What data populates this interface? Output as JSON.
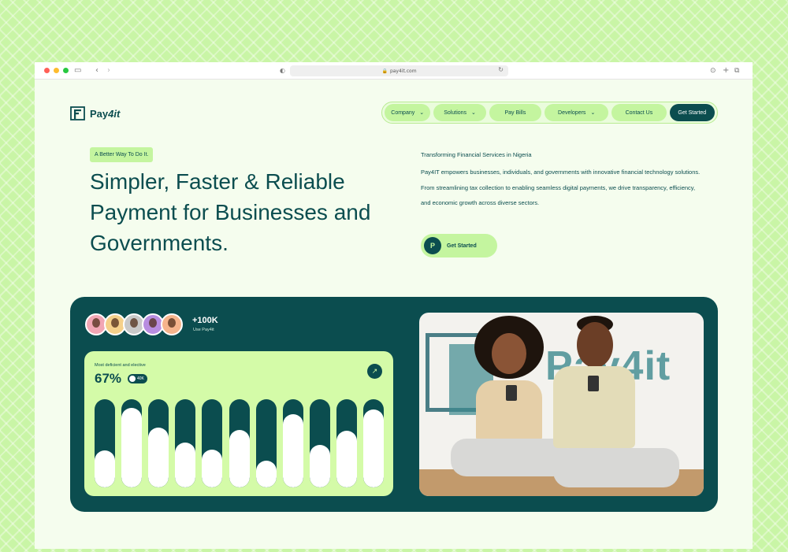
{
  "browser": {
    "url": "pay4it.com",
    "traffic_lights": [
      "#ff5f57",
      "#febc2e",
      "#28c840"
    ]
  },
  "brand": {
    "logo_mark": "P",
    "name_bold": "Pay",
    "name_italic": "4it",
    "primary": "#0b4d4f",
    "accent": "#c4f59f"
  },
  "nav": {
    "items": [
      {
        "label": "Company",
        "dropdown": true
      },
      {
        "label": "Solutions",
        "dropdown": true
      },
      {
        "label": "Pay Bills",
        "dropdown": false
      },
      {
        "label": "Developers",
        "dropdown": true
      },
      {
        "label": "Contact Us",
        "dropdown": false
      }
    ],
    "cta": "Get Started"
  },
  "hero": {
    "tagline": "A Better Way To Do It.",
    "headline": "Simpler, Faster & Reliable Payment for Businesses and Governments.",
    "subtitle": "Transforming Financial Services in Nigeria",
    "description": "Pay4IT empowers businesses, individuals, and governments with innovative financial technology solutions. From streamlining tax collection to enabling seamless digital payments, we drive transparency, efficiency, and economic growth across diverse sectors.",
    "cta": "Get Started",
    "cta_icon": "P"
  },
  "stats": {
    "users_count": "+100K",
    "users_label": "Use Pay4it",
    "avatar_colors": [
      "#f2a6b4",
      "#f5d08a",
      "#c9c9c9",
      "#b88de0",
      "#f6b48c"
    ]
  },
  "chart_card": {
    "label": "Most deficient  and elective",
    "percentage": "67%",
    "badge": "40K",
    "arrow_icon": "↗"
  },
  "chart_data": {
    "type": "bar",
    "values": [
      42,
      90,
      68,
      51,
      43,
      65,
      30,
      83,
      48,
      64,
      88
    ],
    "ylim": [
      0,
      100
    ]
  },
  "photo": {
    "watermark_text": "Pay4it"
  }
}
